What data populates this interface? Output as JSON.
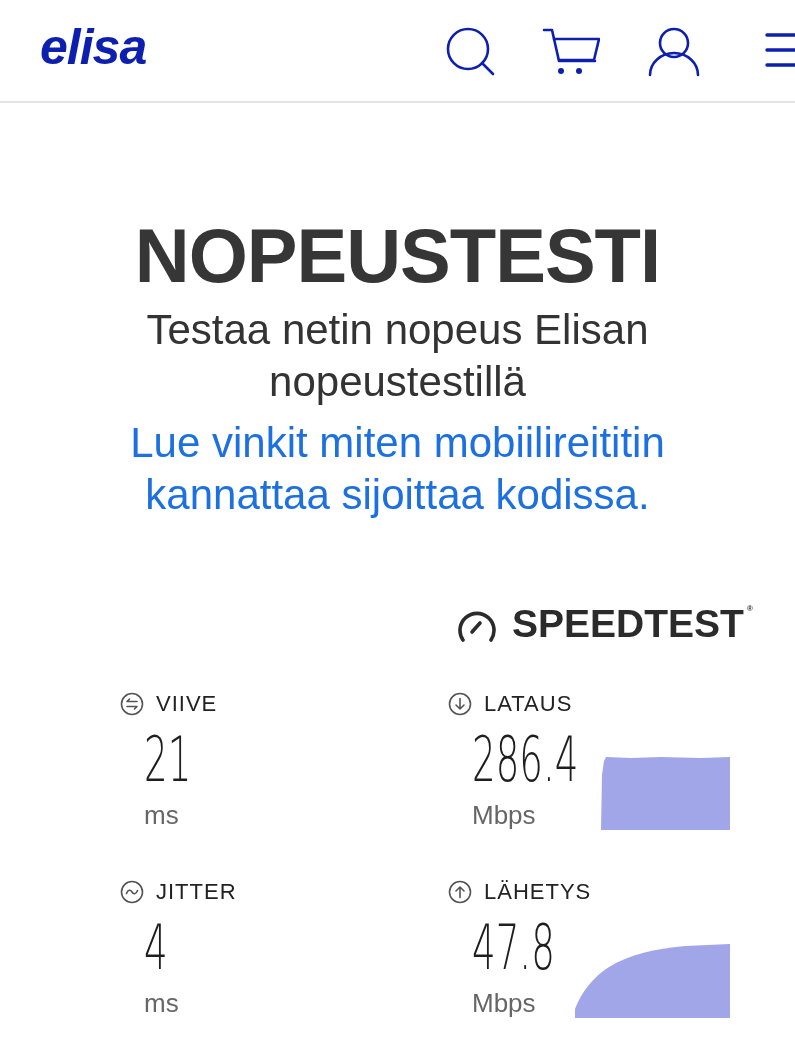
{
  "header": {
    "logo": "elisa"
  },
  "hero": {
    "title": "NOPEUSTESTI",
    "subtitle": "Testaa netin nopeus Elisan nopeustestillä",
    "link": "Lue vinkit miten mobiilireititin kannattaa sijoittaa kodissa."
  },
  "speedtest": {
    "brand": "SPEEDTEST$^{®}$",
    "metrics": [
      {
        "kind": "latency",
        "label": "VIIVE",
        "value": "21",
        "unit": "ms"
      },
      {
        "kind": "download",
        "label": "LATAUS",
        "value": "286.4",
        "unit": "Mbps"
      },
      {
        "kind": "jitter",
        "label": "JITTER",
        "value": "4",
        "unit": "ms"
      },
      {
        "kind": "upload",
        "label": "LÄHETYS",
        "value": "47.8",
        "unit": "Mbps"
      }
    ]
  }
}
